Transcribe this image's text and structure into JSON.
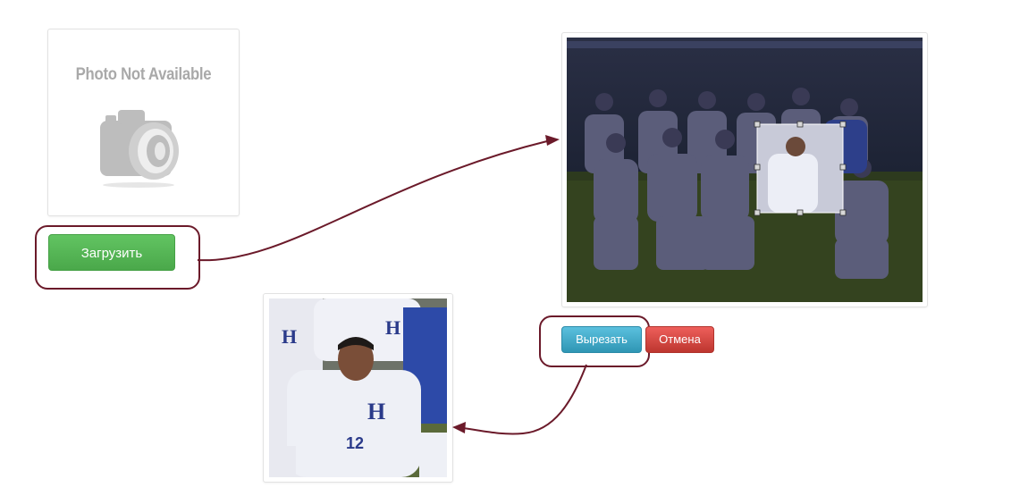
{
  "placeholder": {
    "text": "Photo Not Available",
    "icon": "camera-icon"
  },
  "buttons": {
    "upload": "Загрузить",
    "crop": "Вырезать",
    "cancel": "Отмена"
  },
  "photo": {
    "description_icon": "team-photo"
  },
  "colors": {
    "annotation": "#6b1a2a",
    "upload": "#5cb85c",
    "crop": "#3aa6c8",
    "cancel": "#d9534f"
  }
}
